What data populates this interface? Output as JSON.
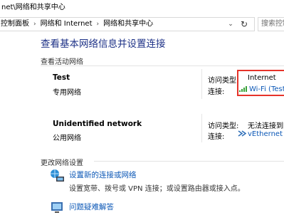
{
  "window": {
    "title": "net\\网络和共享中心"
  },
  "address": {
    "crumbs": [
      "控制面板",
      "网络和 Internet",
      "网络和共享中心"
    ],
    "search_placeholder": "搜索控制面"
  },
  "main": {
    "heading": "查看基本网络信息并设置连接",
    "active_networks_label": "查看活动网络",
    "networks": [
      {
        "name": "Test",
        "type": "专用网络",
        "access_type_label": "访问类型:",
        "access_type_value": "Internet",
        "connection_label": "连接:",
        "connection_value": "Wi-Fi (Test)"
      },
      {
        "name": "Unidentified network",
        "type": "公用网络",
        "access_type_label": "访问类型:",
        "access_type_value": "无法连接到网",
        "connection_label": "连接:",
        "connection_value": "vEthernet (De"
      }
    ],
    "change_settings_label": "更改网络设置",
    "tasks": [
      {
        "title": "设置新的连接或网络",
        "desc": "设置宽带、拨号或 VPN 连接；或设置路由器或接入点。",
        "icon": "network-setup-icon"
      },
      {
        "title": "问题疑难解答",
        "desc": "",
        "icon": "troubleshoot-icon"
      }
    ]
  },
  "colors": {
    "link": "#0b57b6",
    "heading": "#1e3287",
    "highlight": "#e6332a"
  }
}
